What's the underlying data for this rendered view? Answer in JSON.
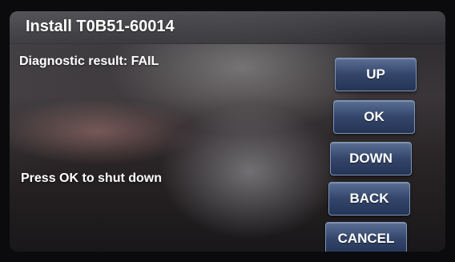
{
  "header": {
    "title": "Install T0B51-60014"
  },
  "messages": {
    "result": "Diagnostic result: FAIL",
    "instruction": "Press OK to shut down"
  },
  "buttons": {
    "up": "UP",
    "ok": "OK",
    "down": "DOWN",
    "back": "BACK",
    "cancel": "CANCEL"
  },
  "colors": {
    "button": "#33456a",
    "text": "#ffffff"
  }
}
